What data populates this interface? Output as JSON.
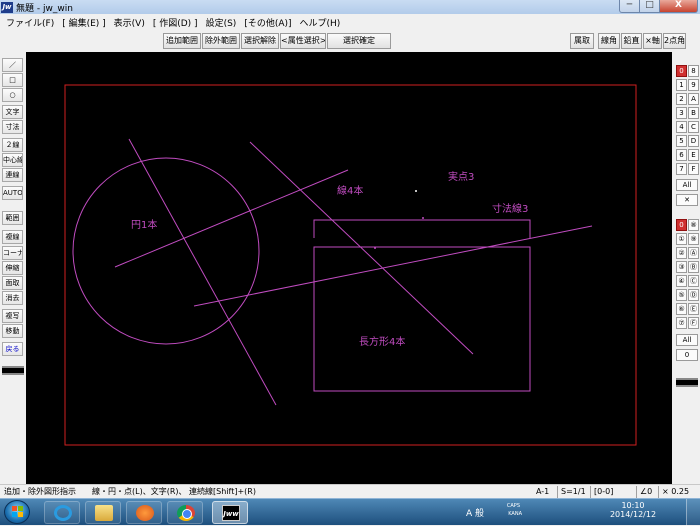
{
  "window": {
    "app_icon": "Jw",
    "title": "無題 - jw_win",
    "min": "─",
    "max": "□",
    "close": "X"
  },
  "menu": [
    "ファイル(F)",
    "[ 編集(E) ]",
    "表示(V)",
    "[ 作図(D) ]",
    "設定(S)",
    "[その他(A)]",
    "ヘルプ(H)"
  ],
  "toolbar": {
    "add_range": "追加範囲",
    "remove_range": "除外範囲",
    "deselect": "選択解除",
    "attr_select": "<属性選択>",
    "confirm": "選択確定",
    "layer_take": "属取",
    "line_angle": "線角",
    "perp_angle": "鉛直",
    "x_axis": "×軸",
    "two_points_angle": "2点角"
  },
  "left_tools": [
    "／",
    "□",
    "○",
    "文字",
    "寸法",
    "２線",
    "中心線",
    "連線",
    "AUTO",
    "範囲",
    "複線",
    "コーナー",
    "伸縮",
    "面取",
    "消去",
    "複写",
    "移動",
    "戻る"
  ],
  "right_palette": {
    "top_grid": [
      "0",
      "8",
      "1",
      "9",
      "2",
      "A",
      "3",
      "B",
      "4",
      "C",
      "5",
      "D",
      "6",
      "E",
      "7",
      "F"
    ],
    "top_all": "All",
    "top_x": "✕",
    "bottom_grid": [
      "0",
      "⑧",
      "①",
      "⑨",
      "②",
      "Ⓐ",
      "③",
      "Ⓑ",
      "④",
      "Ⓒ",
      "⑤",
      "Ⓓ",
      "⑥",
      "Ⓔ",
      "⑦",
      "Ⓕ"
    ],
    "bottom_all": "All",
    "bottom_zero": "0"
  },
  "canvas_labels": {
    "circle": "円1本",
    "lines": "線4本",
    "points": "実点3",
    "dimension": "寸法線3",
    "rectangle": "長方形4本"
  },
  "status": {
    "message": "追加・除外図形指示　　線・円・点(L)、文字(R)、 連続線[Shift]+(R)",
    "paper": "A-1",
    "scale": "S=1/1",
    "layer": "[0-0]",
    "angle": "∠0",
    "zoom": "× 0.25"
  },
  "taskbar": {
    "jww_label": "Jww",
    "ime": "A 般",
    "caps": "CAPS",
    "kana": "KANA",
    "time": "10:10",
    "date": "2014/12/12"
  },
  "colors": {
    "canvas": "#000000",
    "frame": "#d02020",
    "entity": "#c04cc0",
    "selected_layer": "#d03030"
  }
}
